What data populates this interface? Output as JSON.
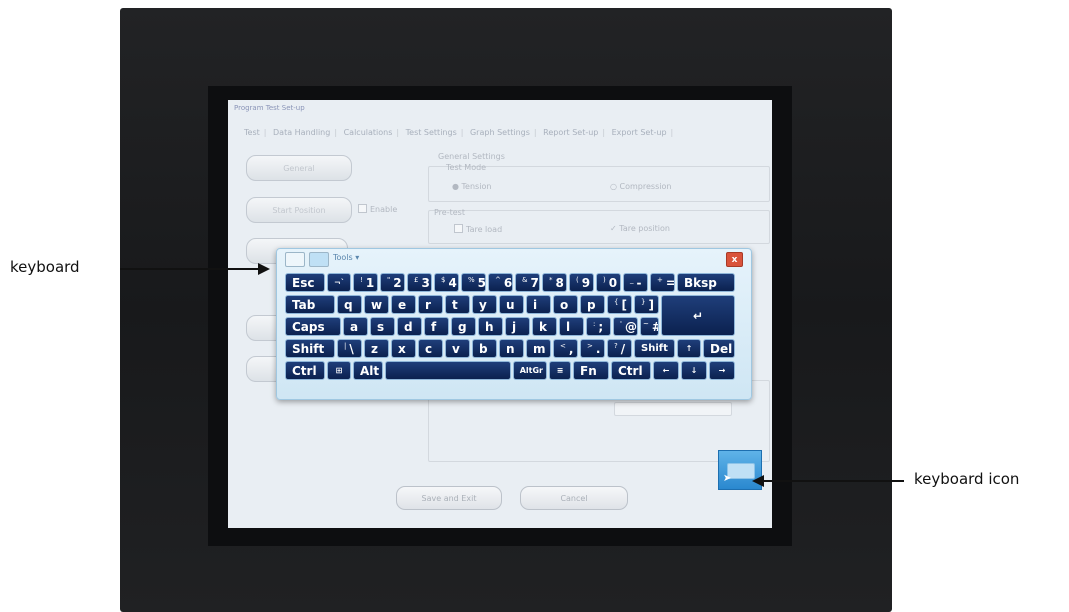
{
  "window_title": "Program Test Set-up",
  "tabs": [
    "Test",
    "Data Handling",
    "Calculations",
    "Test Settings",
    "Graph Settings",
    "Report Set-up",
    "Export Set-up"
  ],
  "side_buttons": {
    "general": "General",
    "start_position": "Start Position"
  },
  "enable_label": "Enable",
  "settings": {
    "section": "General Settings",
    "test_mode": "Test Mode",
    "tension": "Tension",
    "compression": "Compression",
    "pretest": "Pre-test",
    "tare_load": "Tare load",
    "tare_position": "Tare position"
  },
  "bottom_buttons": {
    "save": "Save and Exit",
    "cancel": "Cancel"
  },
  "osk": {
    "tools_label": "Tools",
    "close_glyph": "x",
    "keys": {
      "esc": "Esc",
      "k1": "1",
      "k2": "2",
      "k3": "3",
      "k4": "4",
      "k5": "5",
      "k6": "6",
      "k7": "7",
      "k8": "8",
      "k9": "9",
      "k0": "0",
      "minus": "-",
      "equals": "=",
      "bksp": "Bksp",
      "tab": "Tab",
      "q": "q",
      "w": "w",
      "e": "e",
      "r": "r",
      "t": "t",
      "y": "y",
      "u": "u",
      "i": "i",
      "o": "o",
      "p": "p",
      "lbracket": "[",
      "rbracket": "]",
      "caps": "Caps",
      "a": "a",
      "s": "s",
      "d": "d",
      "f": "f",
      "g": "g",
      "h": "h",
      "j": "j",
      "k": "k",
      "l": "l",
      "semicolon": ";",
      "quote": "@",
      "hash": "#",
      "shift": "Shift",
      "backslash": "\\",
      "z": "z",
      "x": "x",
      "c": "c",
      "v": "v",
      "b": "b",
      "n": "n",
      "m": "m",
      "comma": ",",
      "period": ".",
      "slash": "/",
      "rshift": "Shift",
      "up": "↑",
      "del": "Del",
      "ctrl": "Ctrl",
      "win": "⊞",
      "alt": "Alt",
      "altgr": "AltGr",
      "menu": "≡",
      "fn": "Fn",
      "rctrl": "Ctrl",
      "left": "←",
      "down": "↓",
      "right": "→",
      "enter": "↵"
    },
    "shift_keys": {
      "k1": "!",
      "k2": "\"",
      "k3": "£",
      "k4": "$",
      "k5": "%",
      "k6": "^",
      "k7": "&",
      "k8": "*",
      "k9": "(",
      "k0": ")",
      "minus": "_",
      "equals": "+",
      "lbracket": "{",
      "rbracket": "}",
      "semicolon": ":",
      "quote": "'",
      "hash": "~",
      "backslash": "|",
      "comma": "<",
      "period": ">",
      "slash": "?",
      "tick": "¬`"
    }
  },
  "annotations": {
    "keyboard": "keyboard",
    "keyboard_icon": "keyboard icon"
  }
}
